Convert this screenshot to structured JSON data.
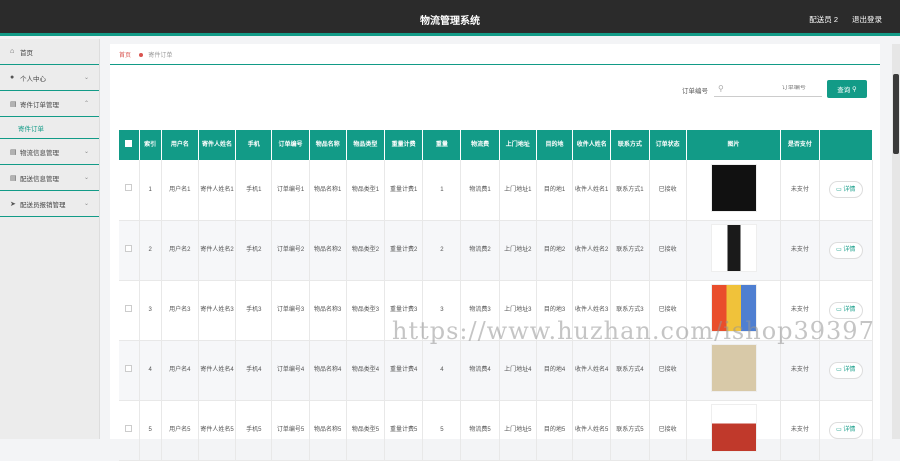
{
  "header": {
    "title": "物流管理系统",
    "user": "配送员 2",
    "logout": "退出登录"
  },
  "sidebar": {
    "items": [
      {
        "label": "首页",
        "icon": "home-icon"
      },
      {
        "label": "个人中心",
        "icon": "user-icon"
      },
      {
        "label": "寄件订单管理",
        "icon": "box-icon"
      },
      {
        "label": "物流信息管理",
        "icon": "box-icon"
      },
      {
        "label": "配送信息管理",
        "icon": "box-icon"
      },
      {
        "label": "配送员报销管理",
        "icon": "send-icon"
      }
    ],
    "sub_item": "寄件订单"
  },
  "breadcrumb": {
    "home": "首页",
    "current": "寄件订单"
  },
  "search": {
    "label": "订单编号",
    "placeholder": "订单编号",
    "button": "查询"
  },
  "table": {
    "headers": [
      "索引",
      "用户名",
      "寄件人姓名",
      "手机",
      "订单编号",
      "物品名称",
      "物品类型",
      "重量计费",
      "重量",
      "物流费",
      "上门地址",
      "目的地",
      "收件人姓名",
      "联系方式",
      "订单状态",
      "图片",
      "是否支付"
    ],
    "rows": [
      {
        "index": "1",
        "username": "用户名1",
        "sender": "寄件人姓名1",
        "phone": "手机1",
        "order_no": "订单编号1",
        "item_name": "物品名称1",
        "item_type": "物品类型1",
        "weight_fee": "重量计费1",
        "weight": "1",
        "freight": "物流费1",
        "address": "上门地址1",
        "destination": "目的地1",
        "receiver": "收件人姓名1",
        "contact": "联系方式1",
        "status": "已接收",
        "paid": "未支付",
        "detail": "详情"
      },
      {
        "index": "2",
        "username": "用户名2",
        "sender": "寄件人姓名2",
        "phone": "手机2",
        "order_no": "订单编号2",
        "item_name": "物品名称2",
        "item_type": "物品类型2",
        "weight_fee": "重量计费2",
        "weight": "2",
        "freight": "物流费2",
        "address": "上门地址2",
        "destination": "目的地2",
        "receiver": "收件人姓名2",
        "contact": "联系方式2",
        "status": "已接收",
        "paid": "未支付",
        "detail": "详情"
      },
      {
        "index": "3",
        "username": "用户名3",
        "sender": "寄件人姓名3",
        "phone": "手机3",
        "order_no": "订单编号3",
        "item_name": "物品名称3",
        "item_type": "物品类型3",
        "weight_fee": "重量计费3",
        "weight": "3",
        "freight": "物流费3",
        "address": "上门地址3",
        "destination": "目的地3",
        "receiver": "收件人姓名3",
        "contact": "联系方式3",
        "status": "已接收",
        "paid": "未支付",
        "detail": "详情"
      },
      {
        "index": "4",
        "username": "用户名4",
        "sender": "寄件人姓名4",
        "phone": "手机4",
        "order_no": "订单编号4",
        "item_name": "物品名称4",
        "item_type": "物品类型4",
        "weight_fee": "重量计费4",
        "weight": "4",
        "freight": "物流费4",
        "address": "上门地址4",
        "destination": "目的地4",
        "receiver": "收件人姓名4",
        "contact": "联系方式4",
        "status": "已接收",
        "paid": "未支付",
        "detail": "详情"
      },
      {
        "index": "5",
        "username": "用户名5",
        "sender": "寄件人姓名5",
        "phone": "手机5",
        "order_no": "订单编号5",
        "item_name": "物品名称5",
        "item_type": "物品类型5",
        "weight_fee": "重量计费5",
        "weight": "5",
        "freight": "物流费5",
        "address": "上门地址5",
        "destination": "目的地5",
        "receiver": "收件人姓名5",
        "contact": "联系方式5",
        "status": "已接收",
        "paid": "未支付",
        "detail": "详情"
      }
    ]
  },
  "watermark": "https://www.huzhan.com/ishop39397",
  "colors": {
    "accent": "#129b87",
    "topbar": "#2b2b2b",
    "breadcrumb_home": "#d9534f"
  }
}
